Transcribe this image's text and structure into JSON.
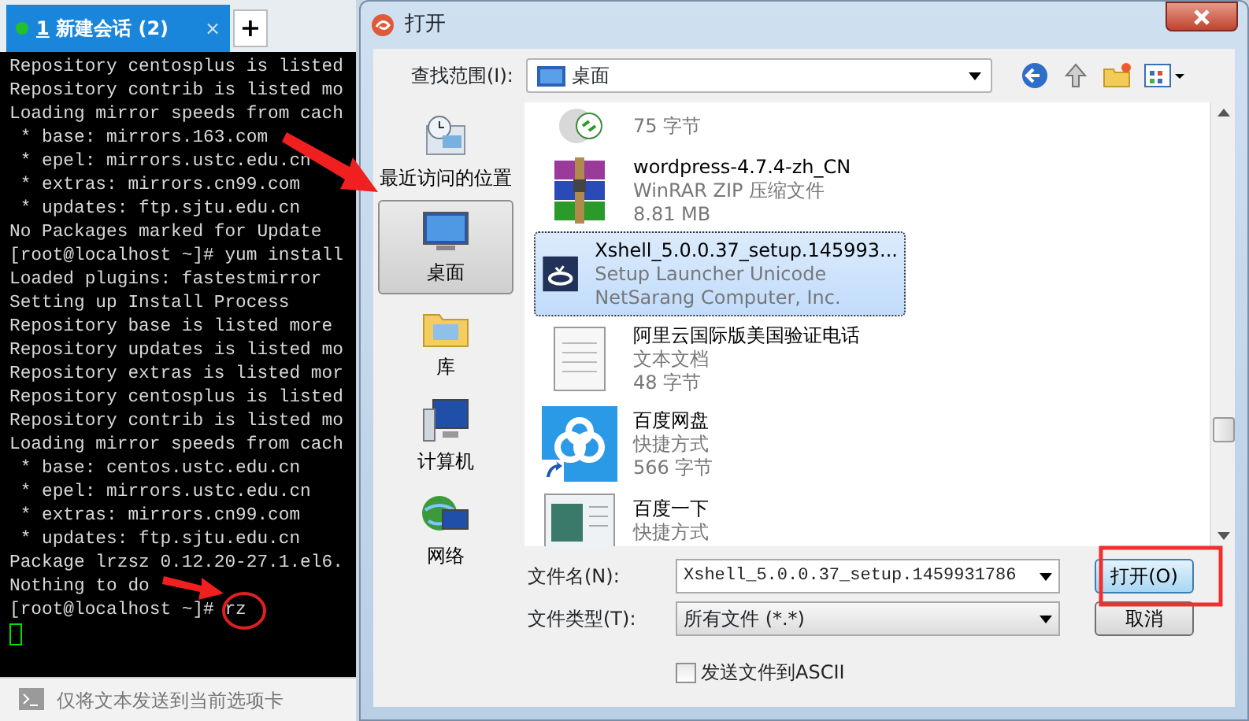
{
  "terminal": {
    "tab": {
      "number": "1",
      "title": "新建会话 (2)",
      "close": "×",
      "connected": true,
      "selected": true
    },
    "new_tab": "+",
    "lines": [
      "Repository centosplus is listed",
      "Repository contrib is listed mo",
      "Loading mirror speeds from cach",
      " * base: mirrors.163.com",
      " * epel: mirrors.ustc.edu.cn",
      " * extras: mirrors.cn99.com",
      " * updates: ftp.sjtu.edu.cn",
      "No Packages marked for Update",
      "[root@localhost ~]# yum install",
      "Loaded plugins: fastestmirror",
      "Setting up Install Process",
      "Repository base is listed more",
      "Repository updates is listed mo",
      "Repository extras is listed mor",
      "Repository centosplus is listed",
      "Repository contrib is listed mo",
      "Loading mirror speeds from cach",
      " * base: centos.ustc.edu.cn",
      " * epel: mirrors.ustc.edu.cn",
      " * extras: mirrors.cn99.com",
      " * updates: ftp.sjtu.edu.cn",
      "Package lrzsz 0.12.20-27.1.el6.",
      "Nothing to do",
      "[root@localhost ~]# rz"
    ],
    "input_bar": {
      "placeholder": "仅将文本发送到当前选项卡"
    }
  },
  "dialog": {
    "title": "打开",
    "look_in": {
      "label": "查找范围(I):",
      "value": "桌面"
    },
    "places": [
      {
        "label": "最近访问的位置",
        "kind": "recent",
        "selected": false
      },
      {
        "label": "桌面",
        "kind": "desktop",
        "selected": true
      },
      {
        "label": "库",
        "kind": "library",
        "selected": false
      },
      {
        "label": "计算机",
        "kind": "computer",
        "selected": false
      },
      {
        "label": "网络",
        "kind": "network",
        "selected": false
      }
    ],
    "files": [
      {
        "kind": "remote",
        "selected": false,
        "lines": [
          "75 字节"
        ]
      },
      {
        "kind": "archive",
        "selected": false,
        "lines": [
          "wordpress-4.7.4-zh_CN",
          "WinRAR ZIP 压缩文件",
          "8.81 MB"
        ]
      },
      {
        "kind": "installer",
        "selected": true,
        "lines": [
          "Xshell_5.0.0.37_setup.145993...",
          "Setup Launcher Unicode",
          "NetSarang Computer, Inc."
        ]
      },
      {
        "kind": "text",
        "selected": false,
        "lines": [
          "阿里云国际版美国验证电话",
          "文本文档",
          "48 字节"
        ]
      },
      {
        "kind": "cloud",
        "selected": false,
        "lines": [
          "百度网盘",
          "快捷方式",
          "566 字节"
        ]
      },
      {
        "kind": "browser",
        "selected": false,
        "lines": [
          "百度一下",
          "快捷方式"
        ]
      }
    ],
    "file_name": {
      "label": "文件名(N):",
      "value": "Xshell_5.0.0.37_setup.1459931786"
    },
    "file_type": {
      "label": "文件类型(T):",
      "value": "所有文件 (*.*)"
    },
    "buttons": [
      {
        "label": "打开(O)",
        "default": true
      },
      {
        "label": "取消",
        "default": false
      }
    ],
    "ascii": {
      "label": "发送文件到ASCII",
      "checked": false
    }
  }
}
